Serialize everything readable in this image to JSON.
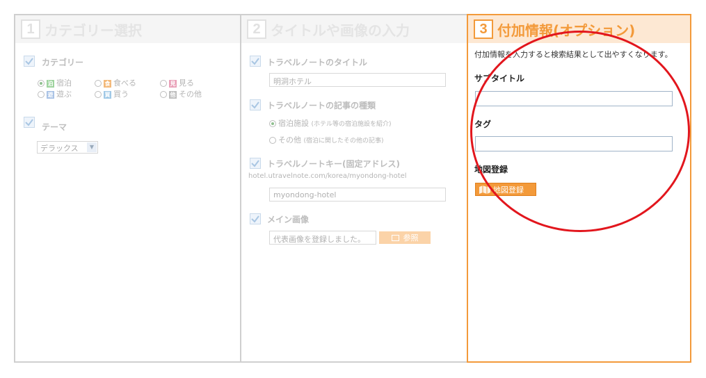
{
  "step1": {
    "number": "1",
    "title": "カテゴリー選択",
    "category_label": "カテゴリー",
    "categories": [
      {
        "icon": "泊",
        "label": "宿泊",
        "color": "#9ed39e",
        "selected": true
      },
      {
        "icon": "食",
        "label": "食べる",
        "color": "#f3b97a",
        "selected": false
      },
      {
        "icon": "見",
        "label": "見る",
        "color": "#e9a0b8",
        "selected": false
      },
      {
        "icon": "遊",
        "label": "遊ぶ",
        "color": "#a6c0e4",
        "selected": false
      },
      {
        "icon": "買",
        "label": "買う",
        "color": "#9fc8e6",
        "selected": false
      },
      {
        "icon": "他",
        "label": "その他",
        "color": "#bdbdbd",
        "selected": false
      }
    ],
    "theme_label": "テーマ",
    "theme_value": "デラックス"
  },
  "step2": {
    "number": "2",
    "title": "タイトルや画像の入力",
    "title_label": "トラベルノートのタイトル",
    "title_value": "明洞ホテル",
    "type_label": "トラベルノートの記事の種類",
    "type_option1": "宿泊施設",
    "type_option1_note": "(ホテル等の宿泊施設を紹介)",
    "type_option2": "その他",
    "type_option2_note": "(宿泊に関したその他の記事)",
    "key_label": "トラベルノートキー(固定アドレス)",
    "key_url": "hotel.utravelnote.com/korea/myondong-hotel",
    "key_value": "myondong-hotel",
    "image_label": "メイン画像",
    "image_value": "代表画像を登録しました。",
    "browse_label": "参照"
  },
  "step3": {
    "number": "3",
    "title": "付加情報(オプション)",
    "description": "付加情報を入力すると検索結果として出やすくなります。",
    "subtitle_label": "サブタイトル",
    "subtitle_value": "",
    "tag_label": "タグ",
    "tag_value": "",
    "map_label": "地図登録",
    "map_button_label": "地図登録"
  },
  "colors": {
    "accent": "#f39a3a",
    "highlight_circle": "#e2161d"
  }
}
